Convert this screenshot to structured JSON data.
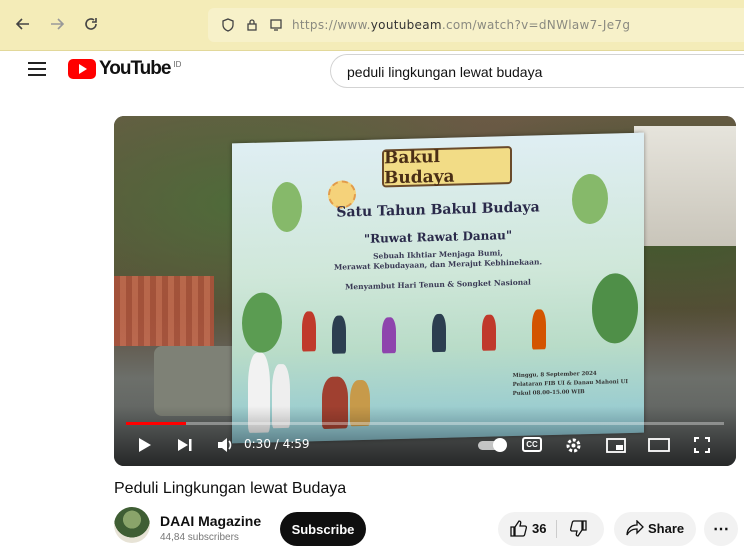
{
  "browser": {
    "url_prefix": "https://www.",
    "url_domain": "youtubeam",
    "url_rest": ".com/watch?v=dNWlaw7-Je7g"
  },
  "youtube": {
    "logo_text": "YouTube",
    "region": "ID",
    "search_value": "peduli lingkungan lewat budaya"
  },
  "player": {
    "banner_logo": "Bakul Budaya",
    "banner_title": "Satu Tahun Bakul Budaya",
    "banner_subtitle": "\"Ruwat Rawat Danau\"",
    "banner_line1": "Sebuah Ikhtiar Menjaga Bumi,",
    "banner_line2": "Merawat Kebudayaan, dan Merajut Kebhinekaan.",
    "banner_line3": "Menyambut Hari Tenun & Songket Nasional",
    "banner_info1": "Minggu, 8 September 2024",
    "banner_info2": "Pelataran FIB UI & Danau Mahoni UI",
    "banner_info3": "Pukul 08.00-15.00 WIB",
    "current_time": "0:30",
    "duration": "4:59",
    "time_display": "0:30 / 4:59",
    "progress": 0.1,
    "cc_label": "CC"
  },
  "video": {
    "title": "Peduli Lingkungan lewat Budaya",
    "channel_name": "DAAI Magazine",
    "subscribers": "44,84 subscribers",
    "subscribe_label": "Subscribe",
    "like_count": "36",
    "share_label": "Share"
  },
  "colors": {
    "browser_bar": "#f4ecb8",
    "yt_red": "#ff0000",
    "subscribe_bg": "#0f0f0f"
  },
  "icons": {
    "back": "arrow-left",
    "forward": "arrow-right",
    "reload": "reload",
    "shield": "shield",
    "lock": "lock",
    "permissions": "permissions",
    "menu": "hamburger",
    "play": "play",
    "next": "skip-next",
    "volume": "volume",
    "settings": "gear",
    "miniplayer": "miniplayer",
    "theater": "theater",
    "fullscreen": "fullscreen",
    "like": "thumbs-up",
    "dislike": "thumbs-down",
    "share": "share-arrow",
    "more": "more-horizontal"
  }
}
